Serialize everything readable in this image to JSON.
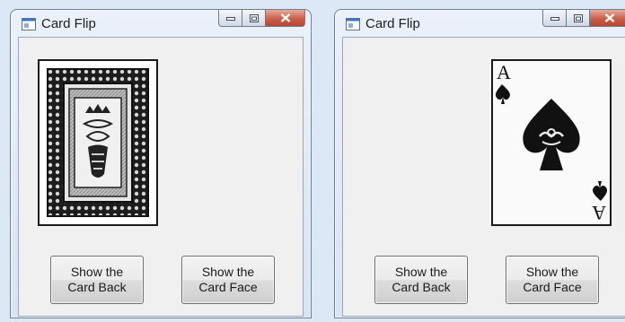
{
  "windows": [
    {
      "title": "Card Flip",
      "card_shown": "back",
      "buttons": {
        "show_back": {
          "line1": "Show the",
          "line2": "Card Back"
        },
        "show_face": {
          "line1": "Show the",
          "line2": "Card Face"
        }
      }
    },
    {
      "title": "Card Flip",
      "card_shown": "face",
      "card": {
        "rank": "A",
        "suit": "spades"
      },
      "buttons": {
        "show_back": {
          "line1": "Show the",
          "line2": "Card Back"
        },
        "show_face": {
          "line1": "Show the",
          "line2": "Card Face"
        }
      }
    }
  ],
  "icons": {
    "app": "form-window-icon",
    "minimize": "minimize-icon",
    "maximize": "maximize-icon",
    "close": "close-icon"
  },
  "colors": {
    "close_button": "#c9604a",
    "client_background": "#f0f0f0",
    "desktop": "#dce8f5"
  }
}
